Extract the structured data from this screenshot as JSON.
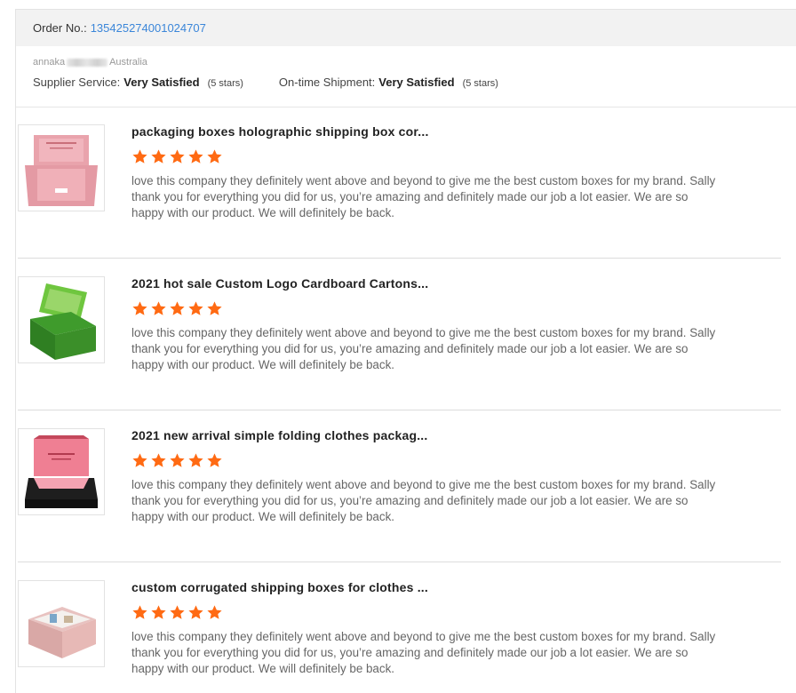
{
  "order": {
    "label": "Order No.:",
    "number": "135425274001024707"
  },
  "buyer": {
    "name": "annaka",
    "country": "Australia"
  },
  "ratings": [
    {
      "label": "Supplier Service:",
      "value": "Very Satisfied",
      "stars": "(5 stars)"
    },
    {
      "label": "On-time Shipment:",
      "value": "Very Satisfied",
      "stars": "(5 stars)"
    }
  ],
  "colors": {
    "star": "#ff6a13",
    "link": "#3b86d9"
  },
  "reviews": [
    {
      "title": "packaging boxes holographic shipping box cor...",
      "rating": 5,
      "text": "love this company they definitely went above and beyond to give me the best custom boxes for my brand. Sally thank you for everything you did for us, you’re amazing and definitely made our job a lot easier. We are so happy with our product. We will definitely be back.",
      "image": "pink-open-mailer-box"
    },
    {
      "title": "2021 hot sale Custom Logo Cardboard Cartons...",
      "rating": 5,
      "text": "love this company they definitely went above and beyond to give me the best custom boxes for my brand. Sally thank you for everything you did for us, you’re amazing and definitely made our job a lot easier. We are so happy with our product. We will definitely be back.",
      "image": "green-open-box"
    },
    {
      "title": "2021 new arrival simple folding clothes packag...",
      "rating": 5,
      "text": "love this company they definitely went above and beyond to give me the best custom boxes for my brand. Sally thank you for everything you did for us, you’re amazing and definitely made our job a lot easier. We are so happy with our product. We will definitely be back.",
      "image": "pink-black-clothes-box"
    },
    {
      "title": "custom corrugated shipping boxes for clothes ...",
      "rating": 5,
      "text": "love this company they definitely went above and beyond to give me the best custom boxes for my brand. Sally thank you for everything you did for us, you’re amazing and definitely made our job a lot easier. We are so happy with our product. We will definitely be back.",
      "image": "pink-shipping-box-with-items"
    }
  ]
}
